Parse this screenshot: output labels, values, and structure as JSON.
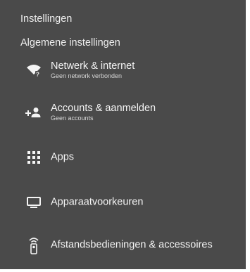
{
  "header": {
    "title": "Instellingen",
    "section_title": "Algemene instellingen"
  },
  "items": [
    {
      "label": "Netwerk & internet",
      "sublabel": "Geen network verbonden",
      "icon": "wifi-off-icon"
    },
    {
      "label": "Accounts & aanmelden",
      "sublabel": "Geen accounts",
      "icon": "add-account-icon"
    },
    {
      "label": "Apps",
      "sublabel": "",
      "icon": "apps-grid-icon"
    },
    {
      "label": "Apparaatvoorkeuren",
      "sublabel": "",
      "icon": "tv-icon"
    },
    {
      "label": "Afstandsbedieningen & accessoires",
      "sublabel": "",
      "icon": "remote-icon"
    }
  ],
  "colors": {
    "panel_background": "#4a4a4a",
    "text": "#f4f4f4",
    "subtext": "#d8d8d8"
  }
}
